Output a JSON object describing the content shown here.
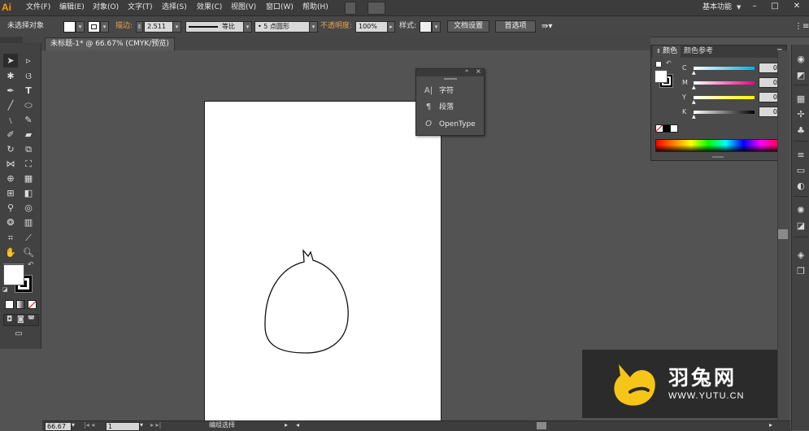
{
  "app": {
    "logo": "Ai",
    "workspace": "基本功能"
  },
  "menu": [
    "文件(F)",
    "编辑(E)",
    "对象(O)",
    "文字(T)",
    "选择(S)",
    "效果(C)",
    "视图(V)",
    "窗口(W)",
    "帮助(H)"
  ],
  "window_controls": {
    "minimize": "–",
    "maximize": "□",
    "close": "✕"
  },
  "control_bar": {
    "selection_status": "未选择对象",
    "stroke_label": "描边:",
    "stroke_weight": "2.511",
    "stroke_profile": "等比",
    "brush": "5 点圆形",
    "opacity_label": "不透明度:",
    "opacity_value": "100%",
    "style_label": "样式:",
    "doc_setup_button": "文档设置",
    "preferences_button": "首选项"
  },
  "document_tab": "未标题-1* @ 66.67% (CMYK/预览)",
  "character_panel": {
    "items": [
      {
        "icon": "A|",
        "label": "字符"
      },
      {
        "icon": "¶",
        "label": "段落"
      },
      {
        "icon": "O",
        "label": "OpenType"
      }
    ]
  },
  "color_panel": {
    "tabs": [
      "颜色",
      "颜色参考"
    ],
    "channels": [
      {
        "name": "C",
        "value": "0",
        "unit": "%",
        "gradient": "linear-gradient(to right,#ffffff,#00aeef)"
      },
      {
        "name": "M",
        "value": "0",
        "unit": "%",
        "gradient": "linear-gradient(to right,#ffffff,#ec008c)"
      },
      {
        "name": "Y",
        "value": "0",
        "unit": "%",
        "gradient": "linear-gradient(to right,#ffffff,#fff200)"
      },
      {
        "name": "K",
        "value": "0",
        "unit": "%",
        "gradient": "linear-gradient(to right,#ffffff,#000000)"
      }
    ]
  },
  "status_bar": {
    "zoom": "66.67",
    "page": "1",
    "tool_status": "编组选择"
  },
  "watermark": {
    "text": "羽兔网",
    "url": "WWW.YUTU.CN",
    "logo_color": "#f5c518"
  },
  "colors": {
    "accent_orange": "#ff9a00",
    "link_orange": "#e8a34a",
    "ui_bg": "#535353"
  }
}
